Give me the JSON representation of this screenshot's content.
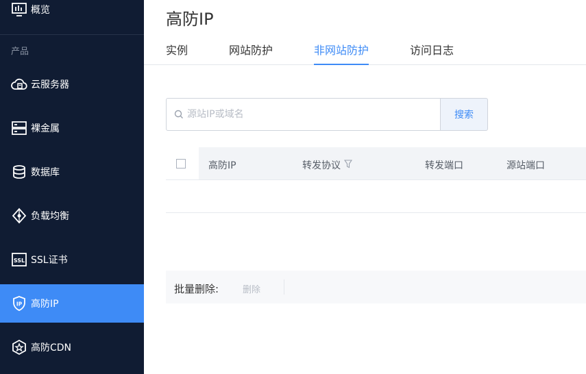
{
  "sidebar": {
    "overview_label": "概览",
    "group_label": "产品",
    "items": [
      {
        "label": "云服务器",
        "icon": "cloud-server-icon"
      },
      {
        "label": "裸金属",
        "icon": "bare-metal-icon"
      },
      {
        "label": "数据库",
        "icon": "database-icon"
      },
      {
        "label": "负载均衡",
        "icon": "load-balancer-icon"
      },
      {
        "label": "SSL证书",
        "icon": "ssl-certificate-icon"
      },
      {
        "label": "高防IP",
        "icon": "anti-ddos-ip-icon",
        "active": true
      },
      {
        "label": "高防CDN",
        "icon": "anti-ddos-cdn-icon"
      }
    ],
    "colors": {
      "background": "#101c33",
      "active": "#3e8bf6"
    }
  },
  "main": {
    "title": "高防IP",
    "tabs": [
      {
        "label": "实例"
      },
      {
        "label": "网站防护"
      },
      {
        "label": "非网站防护",
        "active": true
      },
      {
        "label": "访问日志"
      }
    ],
    "search": {
      "placeholder": "源站IP或域名",
      "value": "",
      "button_label": "搜索"
    },
    "table": {
      "columns": [
        "高防IP",
        "转发协议",
        "转发端口",
        "源站端口"
      ]
    },
    "batch": {
      "label": "批量删除:",
      "delete_label": "删除"
    },
    "accent_color": "#3e8bf6"
  }
}
